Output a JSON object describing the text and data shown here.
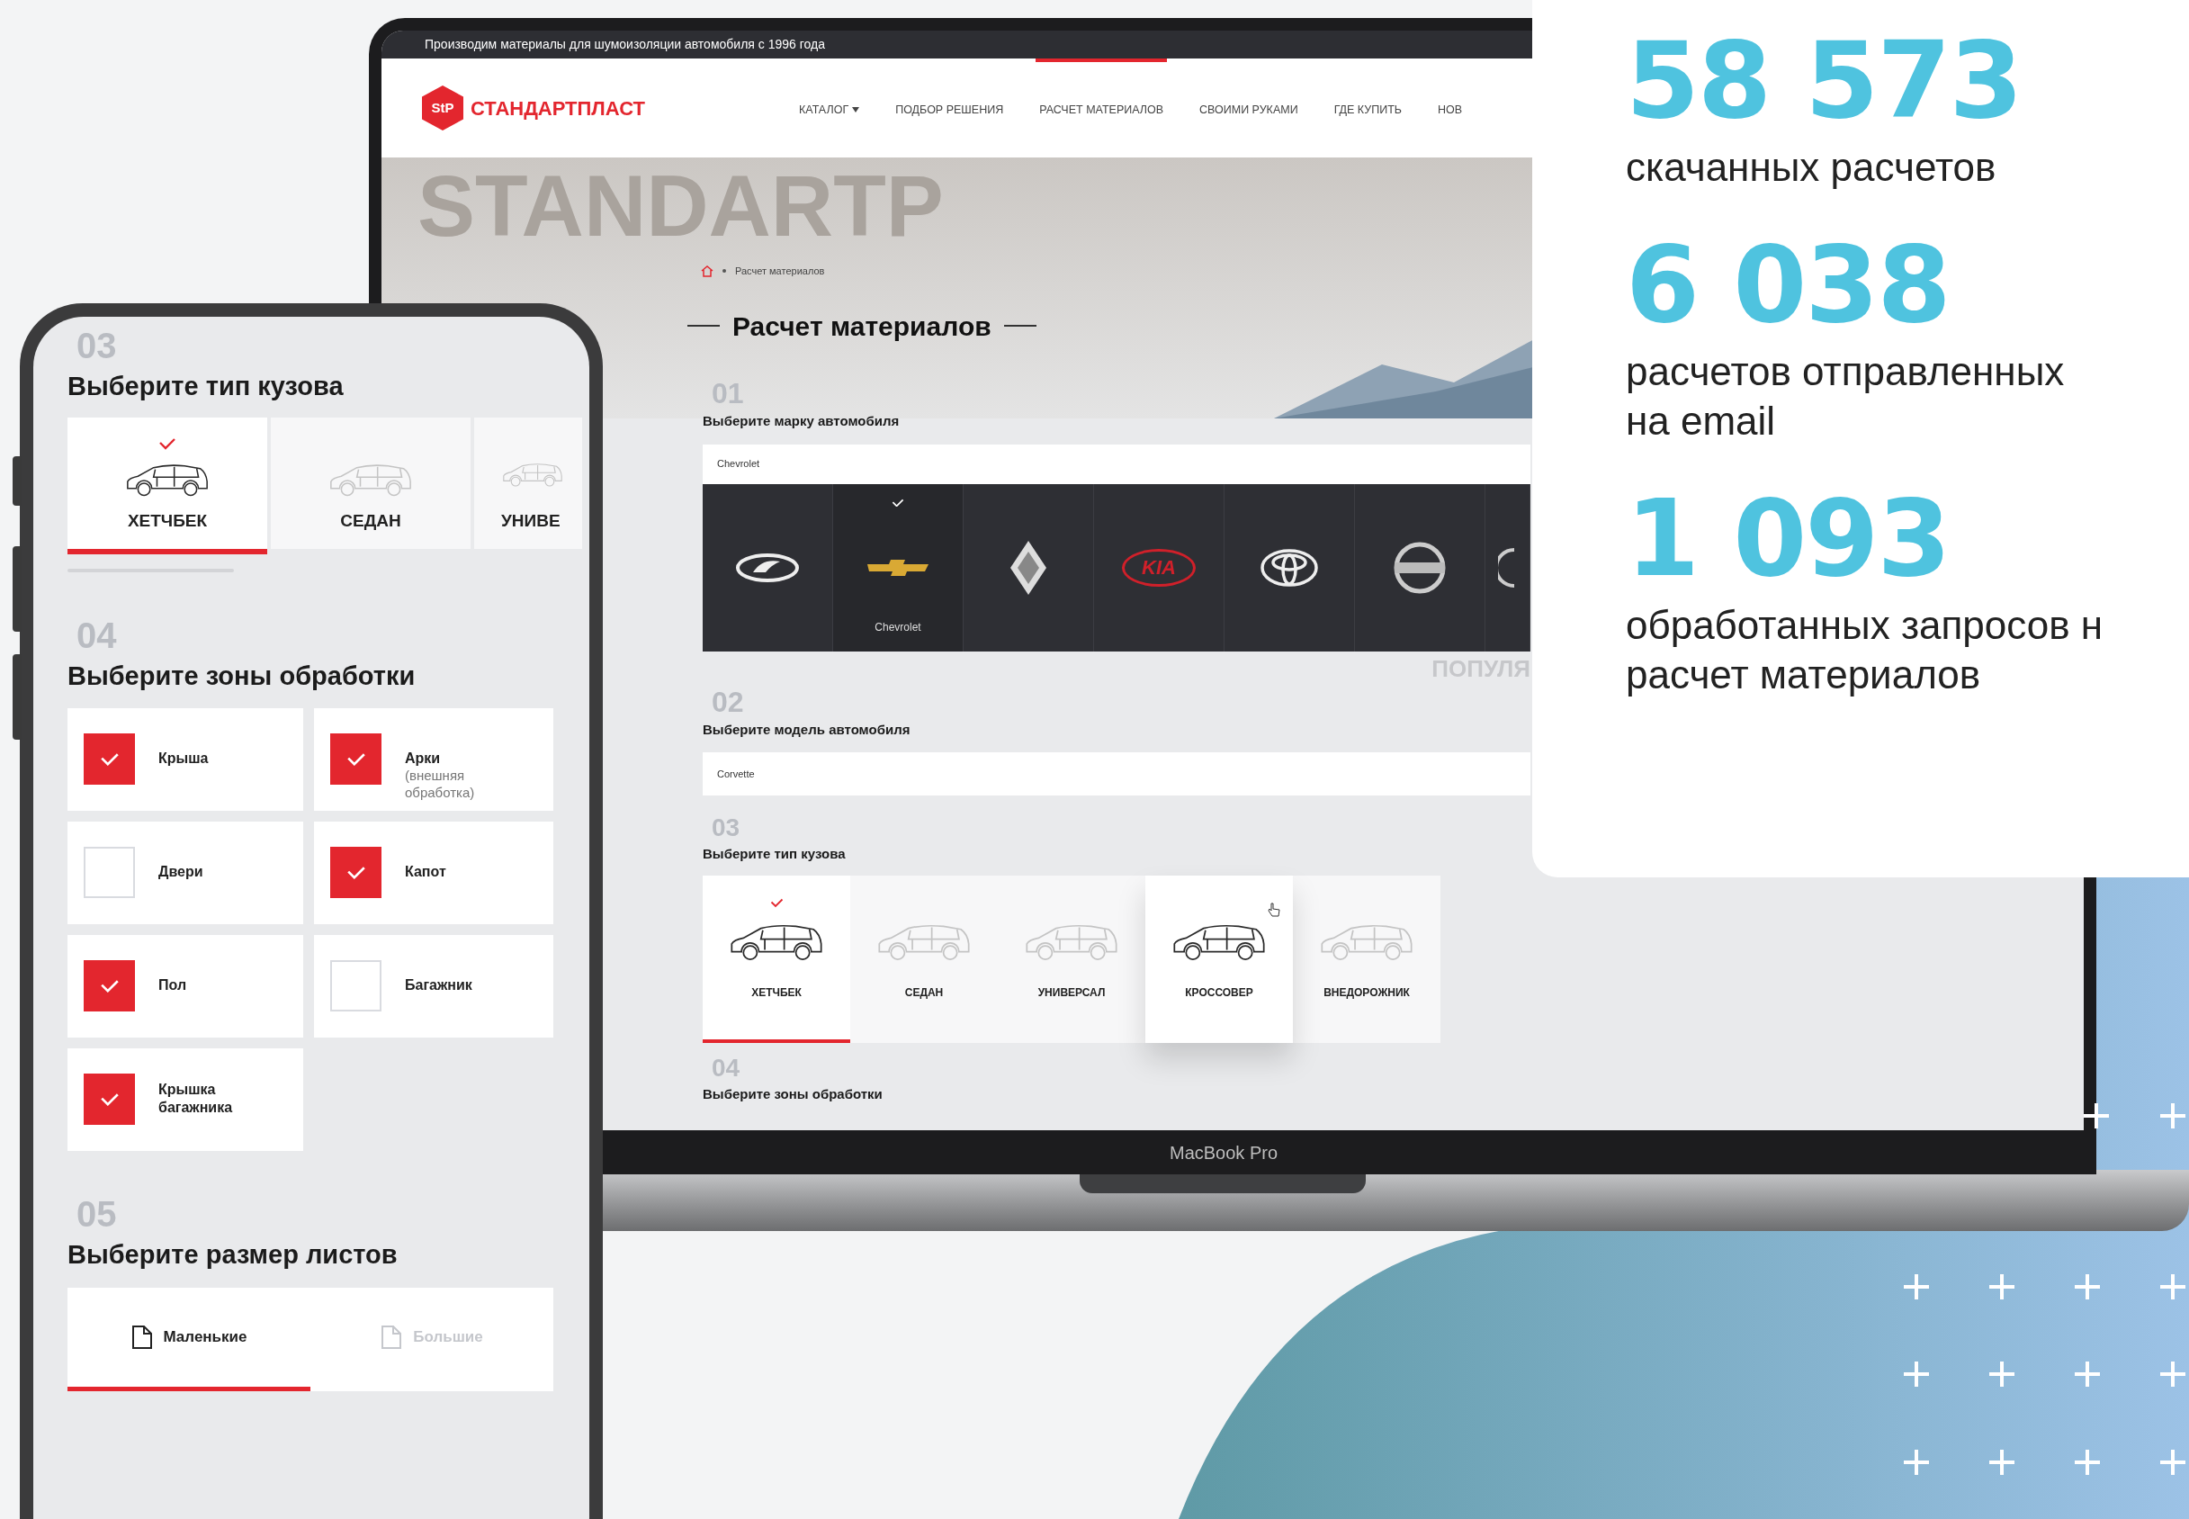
{
  "laptop": {
    "top_bar": "Производим материалы для шумоизоляции автомобиля с 1996 года",
    "logo": {
      "mark": "StP",
      "name": "СТАНДАРТПЛАСТ"
    },
    "nav": [
      {
        "label": "КАТАЛОГ",
        "dropdown": true,
        "selected": false
      },
      {
        "label": "ПОДБОР РЕШЕНИЯ",
        "dropdown": false,
        "selected": false
      },
      {
        "label": "РАСЧЕТ МАТЕРИАЛОВ",
        "dropdown": false,
        "selected": true
      },
      {
        "label": "СВОИМИ РУКАМИ",
        "dropdown": false,
        "selected": false
      },
      {
        "label": "ГДЕ КУПИТЬ",
        "dropdown": false,
        "selected": false
      },
      {
        "label": "НОВ",
        "dropdown": false,
        "selected": false
      }
    ],
    "hero": {
      "backdrop_text": "STANDARTP",
      "breadcrumb": "Расчет материалов",
      "title": "Расчет материалов"
    },
    "brand_section": {
      "number": "01",
      "heading": "Выберите марку автомобиля",
      "value": "Chevrolet",
      "popular_label": "ПОПУЛЯ",
      "brands": [
        {
          "kind": "lada",
          "selected": false
        },
        {
          "kind": "chevrolet",
          "selected": true,
          "label": "Chevrolet"
        },
        {
          "kind": "renault",
          "selected": false
        },
        {
          "kind": "kia",
          "selected": false,
          "logo_text": "KIA"
        },
        {
          "kind": "toyota",
          "selected": false
        },
        {
          "kind": "nissan",
          "selected": false
        },
        {
          "kind": "round",
          "selected": false
        }
      ]
    },
    "model_section": {
      "number": "02",
      "heading": "Выберите модель автомобиля",
      "value": "Corvette"
    },
    "body_section": {
      "number": "03",
      "heading": "Выберите тип кузова",
      "types": [
        {
          "label": "ХЕТЧБЕК",
          "selected": true,
          "hovered": false
        },
        {
          "label": "СЕДАН",
          "selected": false,
          "hovered": false
        },
        {
          "label": "УНИВЕРСАЛ",
          "selected": false,
          "hovered": false
        },
        {
          "label": "КРОССОВЕР",
          "selected": false,
          "hovered": true
        },
        {
          "label": "ВНЕДОРОЖНИК",
          "selected": false,
          "hovered": false
        }
      ]
    },
    "zones_section": {
      "number": "04",
      "heading": "Выберите зоны обработки"
    },
    "model_label": "MacBook Pro"
  },
  "phone": {
    "body_section": {
      "number": "03",
      "heading": "Выберите тип кузова",
      "types": [
        {
          "label": "ХЕТЧБЕК",
          "selected": true
        },
        {
          "label": "СЕДАН",
          "selected": false
        },
        {
          "label": "УНИВЕ",
          "selected": false
        }
      ]
    },
    "zones_section": {
      "number": "04",
      "heading": "Выберите зоны обработки",
      "zones": [
        {
          "label": "Крыша",
          "checked": true
        },
        {
          "label": "Арки",
          "note": "(внешняя\nобработка)",
          "checked": true
        },
        {
          "label": "Двери",
          "checked": false
        },
        {
          "label": "Капот",
          "checked": true
        },
        {
          "label": "Пол",
          "checked": true
        },
        {
          "label": "Багажник",
          "checked": false
        },
        {
          "label": "Крышка\nбагажника",
          "checked": true
        }
      ]
    },
    "sheet_section": {
      "number": "05",
      "heading": "Выберите размер листов",
      "sizes": [
        {
          "label": "Маленькие",
          "selected": true
        },
        {
          "label": "Большие",
          "selected": false
        }
      ]
    }
  },
  "stats": [
    {
      "value": "58 573",
      "caption": "скачанных расчетов"
    },
    {
      "value": "6 038",
      "caption": "расчетов отправленных\nна email"
    },
    {
      "value": "1 093",
      "caption": "обработанных запросов н\nрасчет материалов"
    }
  ]
}
